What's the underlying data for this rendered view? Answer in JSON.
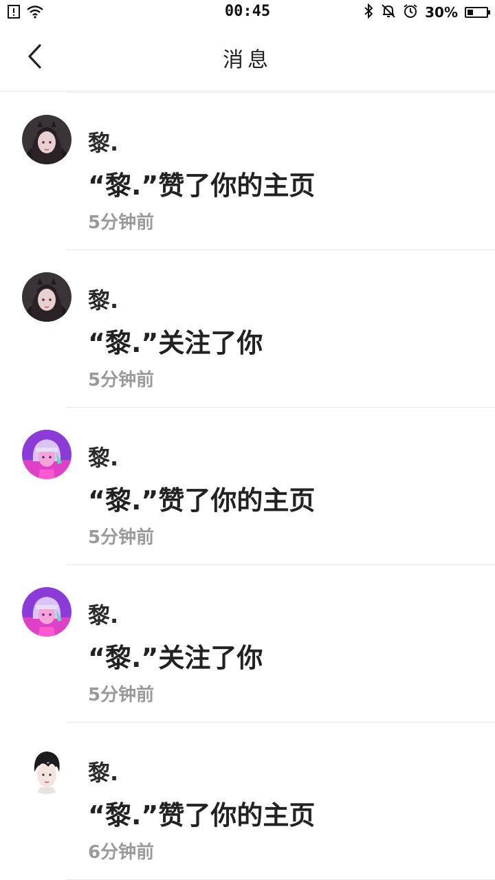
{
  "status_bar": {
    "time": "00:45",
    "battery_percent_label": "30%",
    "battery_level": 0.3,
    "icons": [
      "sim-alert-icon",
      "wifi-icon",
      "bluetooth-icon",
      "mute-icon",
      "alarm-icon",
      "battery-icon"
    ]
  },
  "header": {
    "title": "消息",
    "back_icon": "chevron-left-icon"
  },
  "notifications": [
    {
      "name": "黎.",
      "message": "“黎.”赞了你的主页",
      "time": "5分钟前",
      "avatar": "avatar-dark-hair-girl"
    },
    {
      "name": "黎.",
      "message": "“黎.”关注了你",
      "time": "5分钟前",
      "avatar": "avatar-dark-hair-girl"
    },
    {
      "name": "黎.",
      "message": "“黎.”赞了你的主页",
      "time": "5分钟前",
      "avatar": "avatar-purple-neon-girl"
    },
    {
      "name": "黎.",
      "message": "“黎.”关注了你",
      "time": "5分钟前",
      "avatar": "avatar-purple-neon-girl"
    },
    {
      "name": "黎.",
      "message": "“黎.”赞了你的主页",
      "time": "6分钟前",
      "avatar": "avatar-boy-portrait"
    }
  ]
}
